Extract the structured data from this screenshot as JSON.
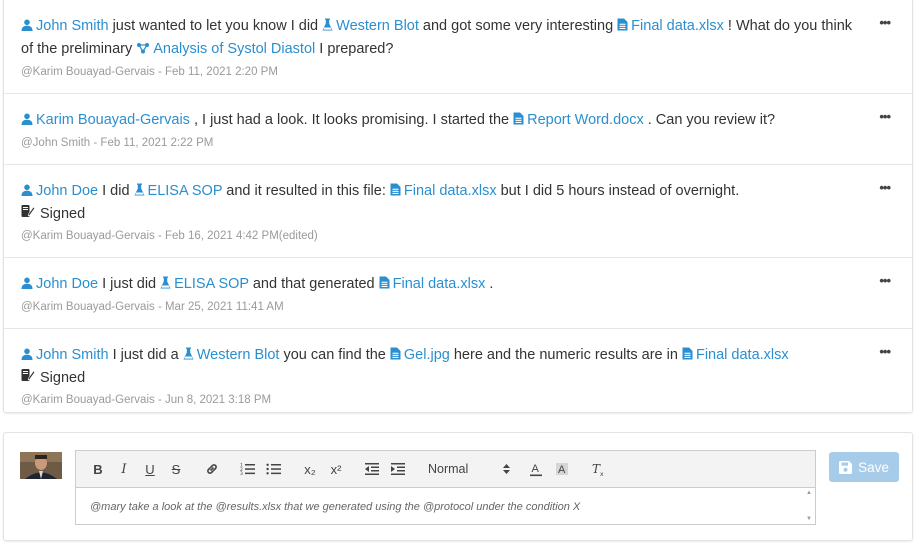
{
  "colors": {
    "link": "#2a8fd0",
    "meta": "#9a9a9a",
    "save_bg": "#a7cce9"
  },
  "comments": [
    {
      "parts": [
        {
          "t": "user",
          "v": "John Smith"
        },
        {
          "t": "text",
          "v": " just wanted to let you know I did "
        },
        {
          "t": "protocol",
          "v": "Western Blot"
        },
        {
          "t": "text",
          "v": " and got some very interesting "
        },
        {
          "t": "file",
          "v": "Final data.xlsx"
        },
        {
          "t": "text",
          "v": " ! What do you think of the preliminary "
        },
        {
          "t": "analysis",
          "v": "Analysis of Systol Diastol"
        },
        {
          "t": "text",
          "v": " I prepared?"
        }
      ],
      "signed": false,
      "meta": "@Karim Bouayad-Gervais - Feb 11, 2021 2:20 PM"
    },
    {
      "parts": [
        {
          "t": "user",
          "v": "Karim Bouayad-Gervais"
        },
        {
          "t": "text",
          "v": " , I just had a look. It looks promising. I started the "
        },
        {
          "t": "file",
          "v": "Report Word.docx"
        },
        {
          "t": "text",
          "v": " . Can you review it?"
        }
      ],
      "signed": false,
      "meta": "@John Smith - Feb 11, 2021 2:22 PM"
    },
    {
      "parts": [
        {
          "t": "user",
          "v": "John Doe"
        },
        {
          "t": "text",
          "v": " I did "
        },
        {
          "t": "protocol",
          "v": "ELISA SOP"
        },
        {
          "t": "text",
          "v": " and it resulted in this file: "
        },
        {
          "t": "file",
          "v": "Final data.xlsx"
        },
        {
          "t": "text",
          "v": " but I did 5 hours instead of overnight."
        }
      ],
      "signed": true,
      "meta": "@Karim Bouayad-Gervais - Feb 16, 2021 4:42 PM(edited)"
    },
    {
      "parts": [
        {
          "t": "user",
          "v": "John Doe"
        },
        {
          "t": "text",
          "v": " I just did "
        },
        {
          "t": "protocol",
          "v": "ELISA SOP"
        },
        {
          "t": "text",
          "v": " and that generated "
        },
        {
          "t": "file",
          "v": "Final data.xlsx"
        },
        {
          "t": "text",
          "v": " ."
        }
      ],
      "signed": false,
      "meta": "@Karim Bouayad-Gervais - Mar 25, 2021 11:41 AM"
    },
    {
      "parts": [
        {
          "t": "user",
          "v": "John Smith"
        },
        {
          "t": "text",
          "v": " I just did a "
        },
        {
          "t": "protocol",
          "v": "Western Blot"
        },
        {
          "t": "text",
          "v": " you can find the "
        },
        {
          "t": "file",
          "v": "Gel.jpg"
        },
        {
          "t": "text",
          "v": " here and the numeric results are in "
        },
        {
          "t": "file",
          "v": "Final data.xlsx"
        }
      ],
      "signed": true,
      "meta": "@Karim Bouayad-Gervais - Jun 8, 2021 3:18 PM"
    }
  ],
  "signed_label": "Signed",
  "menu_label": "•••",
  "composer": {
    "toolbar": {
      "bold": "B",
      "italic": "I",
      "underline": "U",
      "strike": "S",
      "subscript": "x₂",
      "superscript": "x²",
      "size_value": "Normal"
    },
    "text": "@mary take a look at the @results.xlsx that we generated using the @protocol under the condition X",
    "save_label": "Save"
  }
}
